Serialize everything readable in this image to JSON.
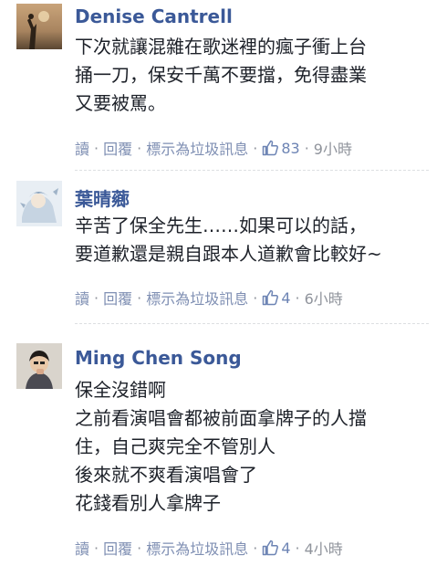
{
  "comments": [
    {
      "author": "Denise Cantrell",
      "lines": [
        "下次就讓混雜在歌迷裡的瘋子衝上台",
        "捅一刀，保安千萬不要擋，免得盡業",
        "又要被罵。"
      ],
      "actions": {
        "read": "讀",
        "reply": "回覆",
        "mark_spam": "標示為垃圾訊息",
        "likes": "83",
        "time": "9小時"
      }
    },
    {
      "author": "葉晴薌",
      "lines": [
        "辛苦了保全先生……如果可以的話，",
        "要道歉還是親自跟本人道歉會比較好~"
      ],
      "actions": {
        "read": "讀",
        "reply": "回覆",
        "mark_spam": "標示為垃圾訊息",
        "likes": "4",
        "time": "6小時"
      }
    },
    {
      "author": "Ming Chen Song",
      "lines": [
        "保全沒錯啊",
        "之前看演唱會都被前面拿牌子的人擋",
        "住，自己爽完全不管別人",
        "後來就不爽看演唱會了",
        "花錢看別人拿牌子"
      ],
      "actions": {
        "read": "讀",
        "reply": "回覆",
        "mark_spam": "標示為垃圾訊息",
        "likes": "4",
        "time": "4小時"
      }
    }
  ],
  "separator": "·",
  "colors": {
    "name": "#3b5998",
    "text": "#1d2129",
    "meta": "#90949c",
    "like_icon": "#6d84b4"
  },
  "icons": {
    "like": "thumbs-up-icon"
  }
}
